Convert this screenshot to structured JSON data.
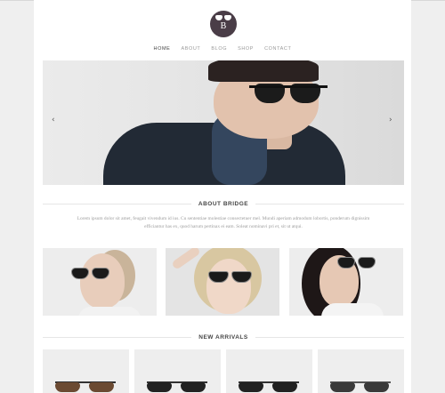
{
  "logo": {
    "letter": "B",
    "icon": "sunglasses-icon",
    "color": "#4a3d47"
  },
  "nav": {
    "items": [
      {
        "label": "HOME",
        "active": true
      },
      {
        "label": "ABOUT",
        "active": false
      },
      {
        "label": "BLOG",
        "active": false
      },
      {
        "label": "SHOP",
        "active": false
      },
      {
        "label": "CONTACT",
        "active": false
      }
    ]
  },
  "hero": {
    "prev_icon": "chevron-left-icon",
    "next_icon": "chevron-right-icon",
    "prev_glyph": "‹",
    "next_glyph": "›"
  },
  "about": {
    "title": "ABOUT BRIDGE",
    "text": "Lorem ipsum dolor sit amet, feugait vivendum id ius. Cu sententiae molestiae consectetuer mel. Mundi aperiam admodum lobortis, ponderum dignissim efficiantur has ex, quod harum pertinax ei eam. Soleat nominavi pri et, sit ut atqui."
  },
  "new_arrivals": {
    "title": "NEW ARRIVALS"
  },
  "colors": {
    "accent": "#4a3d47",
    "text_muted": "#9d9d9d",
    "heading": "#444444"
  }
}
